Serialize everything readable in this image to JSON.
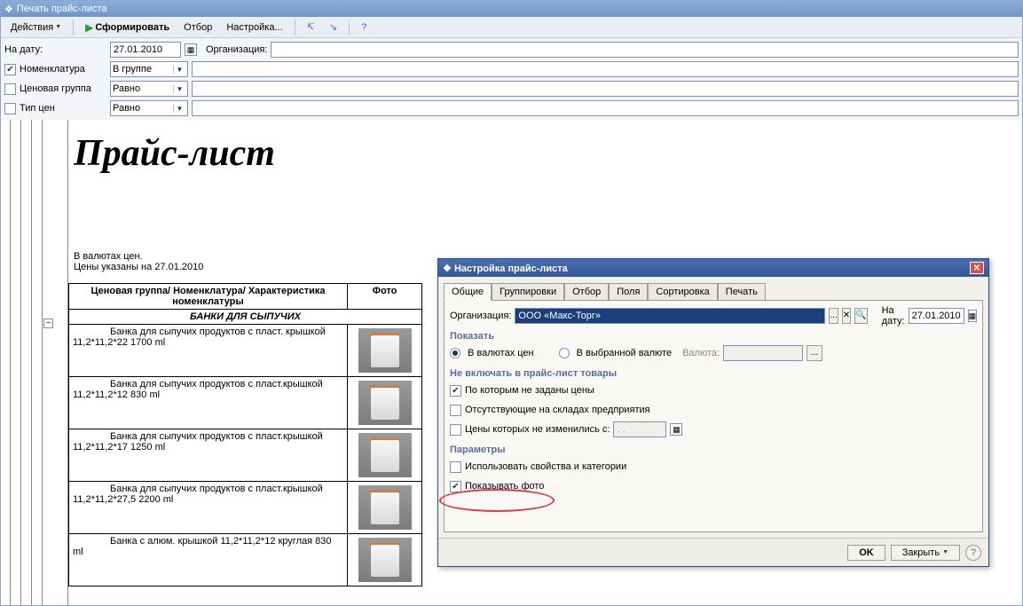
{
  "window_title": "Печать прайс-листа",
  "toolbar": {
    "actions": "Действия",
    "generate": "Сформировать",
    "filter": "Отбор",
    "settings": "Настройка..."
  },
  "filters": {
    "date_label": "На дату:",
    "date_value": "27.01.2010",
    "org_label": "Организация:",
    "nomen_label": "Номенклатура",
    "nomen_mode": "В группе",
    "price_group_label": "Ценовая группа",
    "price_group_mode": "Равно",
    "price_type_label": "Тип цен",
    "price_type_mode": "Равно"
  },
  "doc": {
    "title": "Прайс-лист",
    "currency_note": "В валютах цен.",
    "date_note": "Цены указаны на 27.01.2010",
    "col_desc": "Ценовая группа/ Номенклатура/ Характеристика номенклатуры",
    "col_photo": "Фото",
    "group_name": "БАНКИ ДЛЯ СЫПУЧИХ",
    "rows": [
      {
        "name": "Банка для сыпучих продуктов с пласт. крышкой",
        "spec": "11,2*11,2*22 1700 ml"
      },
      {
        "name": "Банка для сыпучих продуктов с пласт.крышкой",
        "spec": "11,2*11,2*12 830 ml"
      },
      {
        "name": "Банка для сыпучих продуктов с пласт.крышкой",
        "spec": "11,2*11,2*17 1250 ml"
      },
      {
        "name": "Банка для сыпучих продуктов с пласт.крышкой",
        "spec": "11,2*11,2*27,5  2200 ml"
      },
      {
        "name": "Банка с алюм. крышкой 11,2*11,2*12 круглая 830",
        "spec": "ml"
      }
    ]
  },
  "dialog": {
    "title": "Настройка прайс-листа",
    "tabs": [
      "Общие",
      "Группировки",
      "Отбор",
      "Поля",
      "Сортировка",
      "Печать"
    ],
    "org_label": "Организация:",
    "org_value": "ООО «Макс-Торг»",
    "date_label": "На дату:",
    "date_value": "27.01.2010",
    "show_section": "Показать",
    "radio1": "В валютах цен",
    "radio2": "В выбранной валюте",
    "currency_label": "Валюта:",
    "exclude_section": "Не включать в прайс-лист товары",
    "chk_no_price": "По которым не заданы цены",
    "chk_absent": "Отсутствующие на складах предприятия",
    "chk_unchanged": "Цены которых не изменились с:",
    "unchanged_date": ".  .",
    "params_section": "Параметры",
    "chk_props": "Использовать свойства и категории",
    "chk_photo": "Показывать фото",
    "btn_ok": "OK",
    "btn_close": "Закрыть"
  }
}
